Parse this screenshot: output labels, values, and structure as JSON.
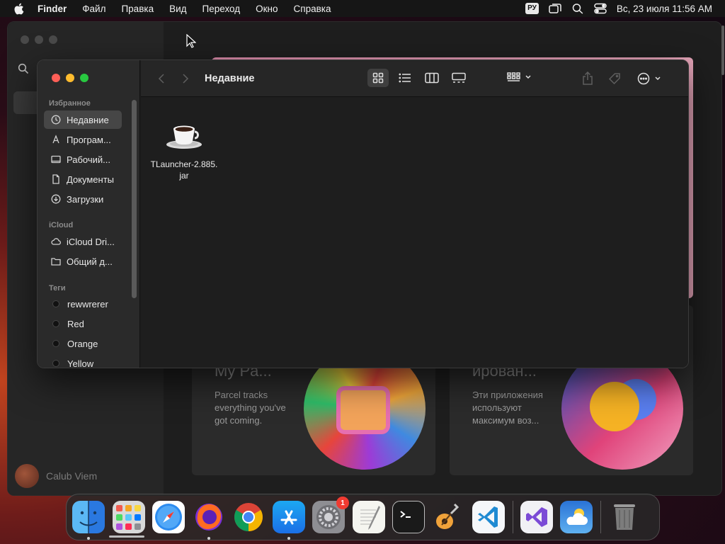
{
  "menubar": {
    "app_name": "Finder",
    "menus": [
      "Файл",
      "Правка",
      "Вид",
      "Переход",
      "Окно",
      "Справка"
    ],
    "input_lang": "РУ",
    "datetime": "Вс, 23 июля  11:56 AM"
  },
  "background_window": {
    "user_name": "Calub Viem",
    "card1": {
      "title": "My Pa...",
      "description": "Parcel tracks everything you've got coming."
    },
    "card2": {
      "title": "ирован...",
      "description": "Эти приложения используют максимум воз..."
    }
  },
  "finder": {
    "title": "Недавние",
    "sidebar": {
      "favorites_label": "Избранное",
      "favorites": [
        "Недавние",
        "Програм...",
        "Рабочий...",
        "Документы",
        "Загрузки"
      ],
      "icloud_label": "iCloud",
      "icloud": [
        "iCloud Dri...",
        "Общий д..."
      ],
      "tags_label": "Теги",
      "tags": [
        "rewwrerer",
        "Red",
        "Orange",
        "Yellow"
      ]
    },
    "files": [
      {
        "name_line1": "TLauncher-2.885.",
        "name_line2": "jar",
        "icon": "java-coffee-icon"
      }
    ]
  },
  "dock": {
    "apps": [
      "Finder",
      "Launchpad",
      "Safari",
      "Firefox",
      "Chrome",
      "App Store",
      "System Settings",
      "TextEdit",
      "Terminal",
      "GarageBand",
      "Visual Studio Code",
      "Visual Studio",
      "Weather",
      "Trash"
    ],
    "settings_badge": "1"
  },
  "colors": {
    "close": "#fe5f57",
    "minimize": "#febc2e",
    "maximize": "#28c840",
    "selection": "#464646",
    "badge": "#f03b32"
  }
}
